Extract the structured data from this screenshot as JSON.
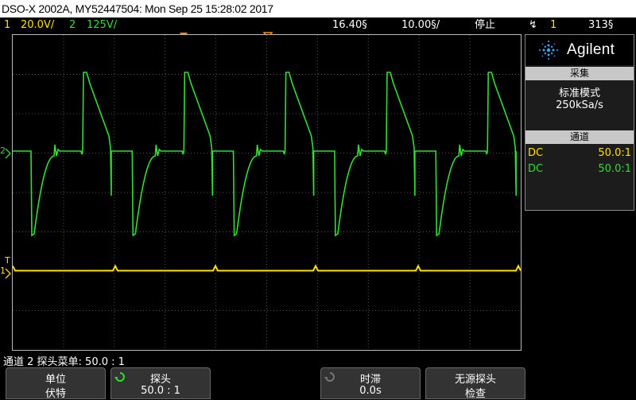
{
  "title_bar": {
    "text": "DSO-X 2002A, MY52447504: Mon Sep 25 15:28:02 2017"
  },
  "status_bar": {
    "ch1_num": "1",
    "ch1_scale": "20.0V/",
    "ch2_num": "2",
    "ch2_scale": "125V/",
    "time_delay": "16.40§",
    "time_base": "10.00§/",
    "run_state": "停止",
    "trigger_icon": "↯",
    "trigger_channel": "1",
    "trigger_level": "313§"
  },
  "colors": {
    "ch1": "#ffe000",
    "ch2": "#33dd33",
    "grid": "#505050",
    "marker": "#ff8c00"
  },
  "graticule": {
    "markers": {
      "ch2_ground": "2",
      "ch1_ground": "1",
      "trigger": "T"
    }
  },
  "right_panel": {
    "brand": "Agilent",
    "brand_icon": "agilent-spark-icon",
    "acquire_header": "采集",
    "acquire_mode": "标准模式",
    "sample_rate": "250kSa/s",
    "channels_header": "通道",
    "channels": [
      {
        "coupling": "DC",
        "ratio": "50.0:1",
        "color": "#ffe000"
      },
      {
        "coupling": "DC",
        "ratio": "50.0:1",
        "color": "#33dd33"
      }
    ]
  },
  "info_line": "通道 2 探头菜单: 50.0 : 1",
  "softkeys": [
    {
      "label": "单位",
      "value": "伏特",
      "spin": false
    },
    {
      "label": "探头",
      "value": "50.0 : 1",
      "spin": true
    },
    {
      "label": "时滞",
      "value": "0.0s",
      "spin": true
    },
    {
      "label": "无源探头",
      "value": "检查",
      "spin": false
    }
  ]
}
